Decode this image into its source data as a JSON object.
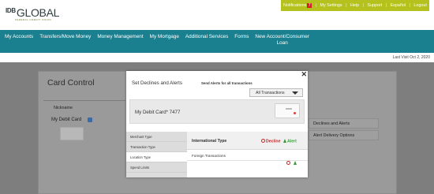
{
  "brand": {
    "prefix": "IDB",
    "name": "GLOBAL",
    "tagline": "FEDERAL CREDIT UNION"
  },
  "utility": {
    "notifications_label": "Notifications",
    "notifications_count": "7",
    "links": [
      "My Settings",
      "Help",
      "Support",
      "Español",
      "Logout"
    ]
  },
  "nav": {
    "items": [
      "My Accounts",
      "Transfers/Move Money",
      "Money Management",
      "My Mortgage",
      "Additional Services",
      "Forms"
    ],
    "new_account_line1": "New Account/Consumer",
    "new_account_line2": "Loan"
  },
  "last_visit": "Last Visit Oct 2, 2020",
  "page": {
    "title": "Card Control",
    "nickname_label": "Nickname",
    "card_name": "My Debit Card",
    "buttons": [
      "Declines and Alerts",
      "Delivery Options"
    ],
    "button_prefixes": [
      "",
      "Alert "
    ]
  },
  "modal": {
    "title": "Set Declines and Alerts",
    "send_alerts": "Send Alerts for all transactions",
    "select_value": "All Transactions",
    "card_label": "My Debit Card* 7477",
    "tabs": [
      "Merchant Type",
      "Transaction Type",
      "Location Type",
      "Spend Limits"
    ],
    "active_tab": "Location Type",
    "section_title": "International Type",
    "decline_label": "Decline",
    "alert_label": "Alert",
    "rows": [
      {
        "label": "Foreign Transactions"
      }
    ]
  },
  "colors": {
    "brand_green": "#b5c21e",
    "nav_teal": "#1a7f8e",
    "decline_red": "#d32020",
    "alert_green": "#3a9a3a"
  }
}
